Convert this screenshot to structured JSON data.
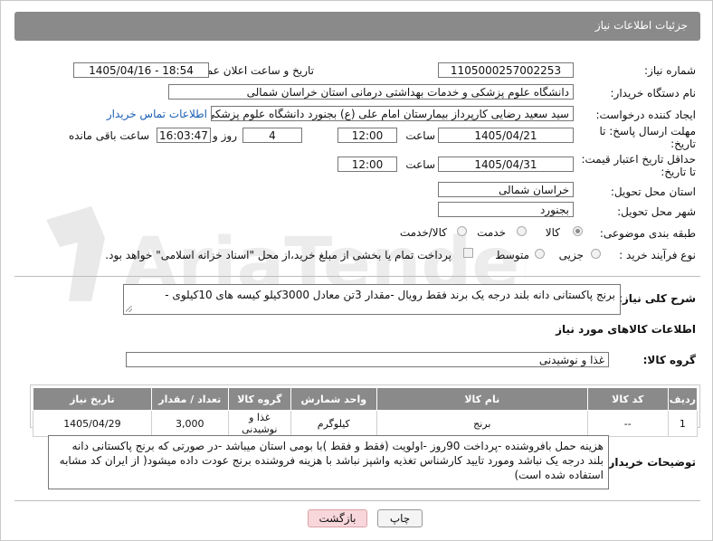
{
  "header": {
    "title": "جزئیات اطلاعات نیاز"
  },
  "labels": {
    "need_number": "شماره نیاز:",
    "announce_datetime": "تاریخ و ساعت اعلان عمومی:",
    "buyer_org": "نام دستگاه خریدار:",
    "requester": "ایجاد کننده درخواست:",
    "reply_deadline_line1": "مهلت ارسال پاسخ: تا",
    "reply_deadline_line2": "تاریخ:",
    "time": "ساعت",
    "day_and": "روز و",
    "remaining": "ساعت باقی مانده",
    "price_validity_line1": "حداقل تاریخ اعتبار قیمت:",
    "price_validity_line2": "تا تاریخ:",
    "time2": "ساعت",
    "delivery_province": "استان محل تحویل:",
    "delivery_city": "شهر محل تحویل:",
    "category": "طبقه بندی موضوعی:",
    "process_type": "نوع فرآیند خرید :",
    "general_desc": "شرح کلی نیاز:",
    "goods_info": "اطلاعات کالاهای مورد نیاز",
    "goods_group": "گروه کالا:",
    "buyer_notes": "توضیحات خریدار:"
  },
  "values": {
    "need_number": "1105000257002253",
    "announce_datetime": "1405/04/16 - 18:54",
    "buyer_org": "دانشگاه علوم پزشکی و خدمات بهداشتی درمانی استان خراسان شمالی",
    "requester": "سید سعید رضایی کارپرداز بیمارستان امام علی (ع) بجنورد دانشگاه علوم پزشکی",
    "contact_link": "اطلاعات تماس خریدار",
    "reply_date": "1405/04/21",
    "reply_time": "12:00",
    "reply_days": "4",
    "reply_remaining": "16:03:47",
    "price_date": "1405/04/31",
    "price_time": "12:00",
    "delivery_province": "خراسان شمالی",
    "delivery_city": "بجنورد",
    "general_desc": "برنج پاکستانی دانه بلند درجه یک برند فقط رویال -مقدار 3تن معادل 3000کیلو کیسه های 10کیلوی -",
    "goods_group": "غذا و نوشیدنی",
    "buyer_notes": "هزینه حمل بافروشنده  -پرداخت 90روز -اولویت (فقط و فقط )با بومی استان میباشد -در صورتی که برنج پاکستانی دانه بلند درجه یک نباشد ومورد تایید کارشناس تغذیه واشپز نباشد با هزینه فروشنده برنج عودت داده میشود( از ایران کد مشابه استفاده شده است)"
  },
  "category_options": [
    {
      "label": "کالا",
      "selected": true
    },
    {
      "label": "خدمت",
      "selected": false
    },
    {
      "label": "کالا/خدمت",
      "selected": false
    }
  ],
  "process_options": [
    {
      "label": "جزیی",
      "selected": false
    },
    {
      "label": "متوسط",
      "selected": false
    }
  ],
  "payment_note": "پرداخت تمام یا بخشی از مبلغ خرید،از محل \"اسناد خزانه اسلامی\" خواهد بود.",
  "table": {
    "headers": [
      "ردیف",
      "کد کالا",
      "نام کالا",
      "واحد شمارش",
      "گروه کالا",
      "تعداد / مقدار",
      "تاریخ نیاز"
    ],
    "rows": [
      [
        "1",
        "--",
        "برنج",
        "کیلوگرم",
        "غذا و نوشیدنی",
        "3,000",
        "1405/04/29"
      ]
    ]
  },
  "buttons": {
    "print": "چاپ",
    "back": "بازگشت"
  },
  "watermark": "AriaTender.neT",
  "colors": {
    "header_bg": "#8a8a8a",
    "link": "#1a5fb4",
    "back_button_bg": "#f8d7da"
  }
}
